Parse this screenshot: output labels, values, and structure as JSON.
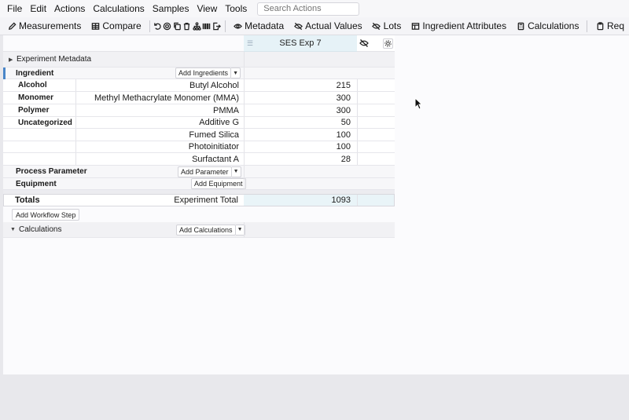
{
  "menubar": {
    "items": [
      "File",
      "Edit",
      "Actions",
      "Calculations",
      "Samples",
      "View",
      "Tools"
    ],
    "search_placeholder": "Search Actions"
  },
  "toolbar": {
    "measurements": "Measurements",
    "compare": "Compare",
    "metadata": "Metadata",
    "actual_values": "Actual Values",
    "lots": "Lots",
    "ingredient_attributes": "Ingredient Attributes",
    "calculations": "Calculations",
    "req": "Req"
  },
  "grid": {
    "column_title": "SES Exp 7",
    "experiment_metadata": "Experiment Metadata",
    "ingredient_label": "Ingredient",
    "add_ingredients": "Add Ingredients",
    "rows": [
      {
        "category": "Alcohol",
        "name": "Butyl Alcohol",
        "value": "215"
      },
      {
        "category": "Monomer",
        "name": "Methyl Methacrylate Monomer (MMA)",
        "value": "300"
      },
      {
        "category": "Polymer",
        "name": "PMMA",
        "value": "300"
      },
      {
        "category": "Uncategorized",
        "name": "Additive G",
        "value": "50"
      },
      {
        "category": "",
        "name": "Fumed Silica",
        "value": "100"
      },
      {
        "category": "",
        "name": "Photoinitiator",
        "value": "100"
      },
      {
        "category": "",
        "name": "Surfactant A",
        "value": "28"
      }
    ],
    "process_parameter": "Process Parameter",
    "add_parameter": "Add Parameter",
    "equipment": "Equipment",
    "add_equipment": "Add Equipment",
    "totals_label": "Totals",
    "experiment_total_label": "Experiment Total",
    "experiment_total_value": "1093",
    "add_workflow_step": "Add Workflow Step",
    "calculations_label": "Calculations",
    "add_calculations": "Add Calculations"
  }
}
